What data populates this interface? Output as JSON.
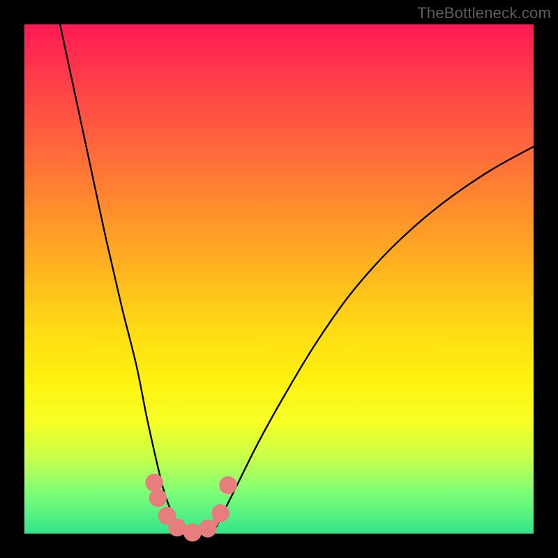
{
  "watermark": "TheBottleneck.com",
  "chart_data": {
    "type": "line",
    "title": "",
    "xlabel": "",
    "ylabel": "",
    "xlim": [
      0,
      100
    ],
    "ylim": [
      0,
      100
    ],
    "grid": false,
    "legend": false,
    "background_gradient": {
      "top": "#ff1a55",
      "middle": "#ffe010",
      "bottom": "#33e58a"
    },
    "series": [
      {
        "name": "left-branch",
        "x": [
          7,
          10,
          13,
          16,
          19,
          22,
          24,
          26,
          27.5,
          29,
          30,
          31
        ],
        "y": [
          100,
          86,
          72,
          58,
          45,
          33,
          23,
          14,
          8,
          4,
          2,
          0
        ],
        "stroke": "#000000"
      },
      {
        "name": "right-branch",
        "x": [
          37,
          39,
          42,
          46,
          51,
          57,
          64,
          72,
          81,
          91,
          100
        ],
        "y": [
          0,
          4,
          10,
          18,
          27,
          37,
          47,
          56,
          64,
          71,
          76
        ],
        "stroke": "#000000"
      },
      {
        "name": "bottom-dip",
        "x": [
          28,
          29.5,
          31,
          33,
          35,
          37,
          38.5
        ],
        "y": [
          4,
          1.5,
          0.5,
          0,
          0.5,
          1.5,
          4
        ],
        "stroke": "#e77d7d"
      }
    ],
    "markers": [
      {
        "x": 25.5,
        "y": 10,
        "r": 1.2,
        "fill": "#e77d7d"
      },
      {
        "x": 26.2,
        "y": 7,
        "r": 1.2,
        "fill": "#e77d7d"
      },
      {
        "x": 28.0,
        "y": 3.5,
        "r": 1.2,
        "fill": "#e77d7d"
      },
      {
        "x": 30.0,
        "y": 1.2,
        "r": 1.2,
        "fill": "#e77d7d"
      },
      {
        "x": 33.0,
        "y": 0.2,
        "r": 1.2,
        "fill": "#e77d7d"
      },
      {
        "x": 36.0,
        "y": 1.0,
        "r": 1.2,
        "fill": "#e77d7d"
      },
      {
        "x": 38.5,
        "y": 4.0,
        "r": 1.2,
        "fill": "#e77d7d"
      },
      {
        "x": 40.0,
        "y": 9.5,
        "r": 1.2,
        "fill": "#e77d7d"
      }
    ]
  }
}
